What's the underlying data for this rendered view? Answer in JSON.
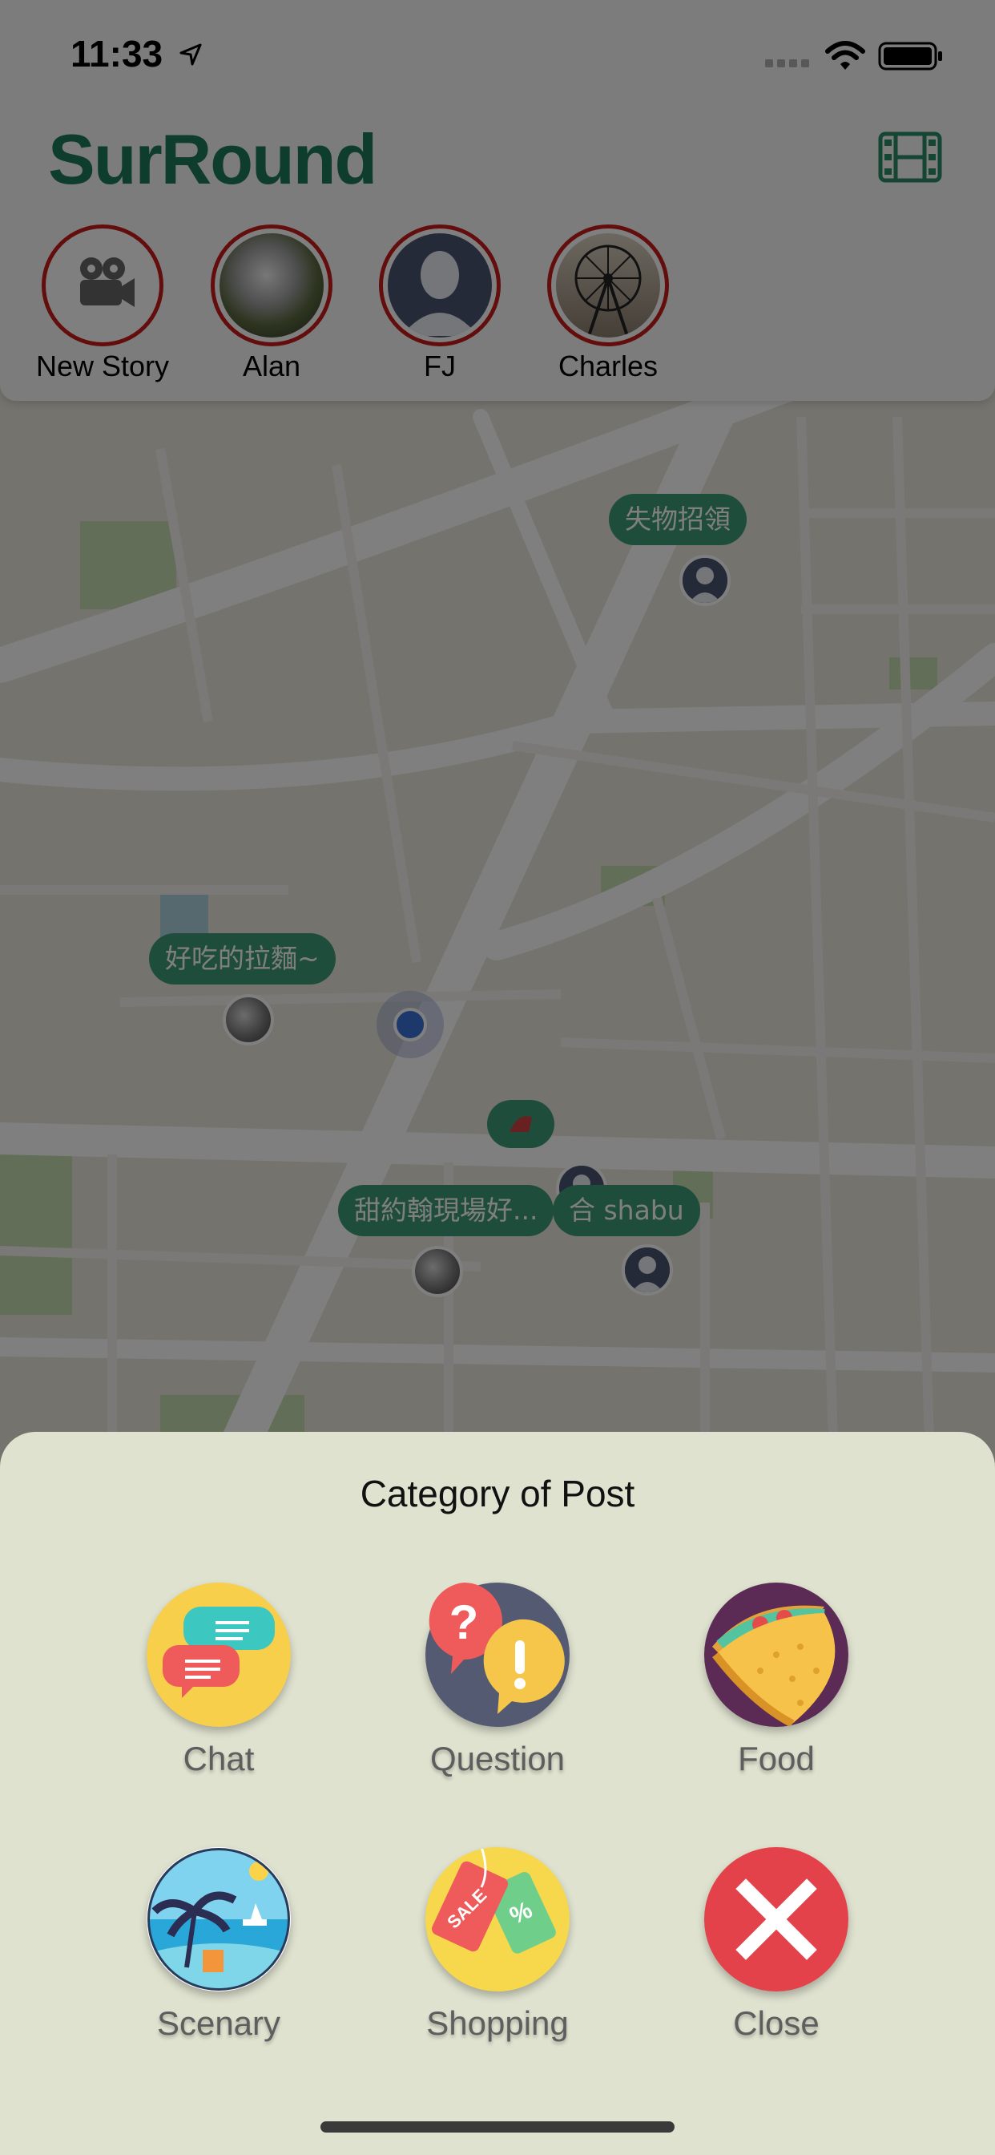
{
  "status_bar": {
    "time": "11:33"
  },
  "header": {
    "app_title": "SurRound",
    "film_icon": "film-icon"
  },
  "stories": [
    {
      "label": "New Story",
      "icon": "video-camera-icon"
    },
    {
      "label": "Alan",
      "icon": "photo-avatar"
    },
    {
      "label": "FJ",
      "icon": "person-silhouette-avatar"
    },
    {
      "label": "Charles",
      "icon": "ferris-wheel-avatar"
    }
  ],
  "map": {
    "bubbles": [
      {
        "text": "失物招領"
      },
      {
        "text": "好吃的拉麵~"
      },
      {
        "text": "甜約翰現場好..."
      },
      {
        "text": "合 shabu"
      }
    ]
  },
  "sheet": {
    "title": "Category of Post",
    "categories": [
      {
        "label": "Chat",
        "icon": "chat-bubbles-icon"
      },
      {
        "label": "Question",
        "icon": "question-exclamation-icon"
      },
      {
        "label": "Food",
        "icon": "taco-icon"
      },
      {
        "label": "Scenary",
        "icon": "beach-scene-icon"
      },
      {
        "label": "Shopping",
        "icon": "sale-tags-icon"
      },
      {
        "label": "Close",
        "icon": "close-x-icon"
      }
    ]
  },
  "colors": {
    "brand": "#1e7a5a",
    "bubble": "#3f9a78",
    "story_ring": "#c61a1a",
    "sheet": "#dfe2cf"
  }
}
